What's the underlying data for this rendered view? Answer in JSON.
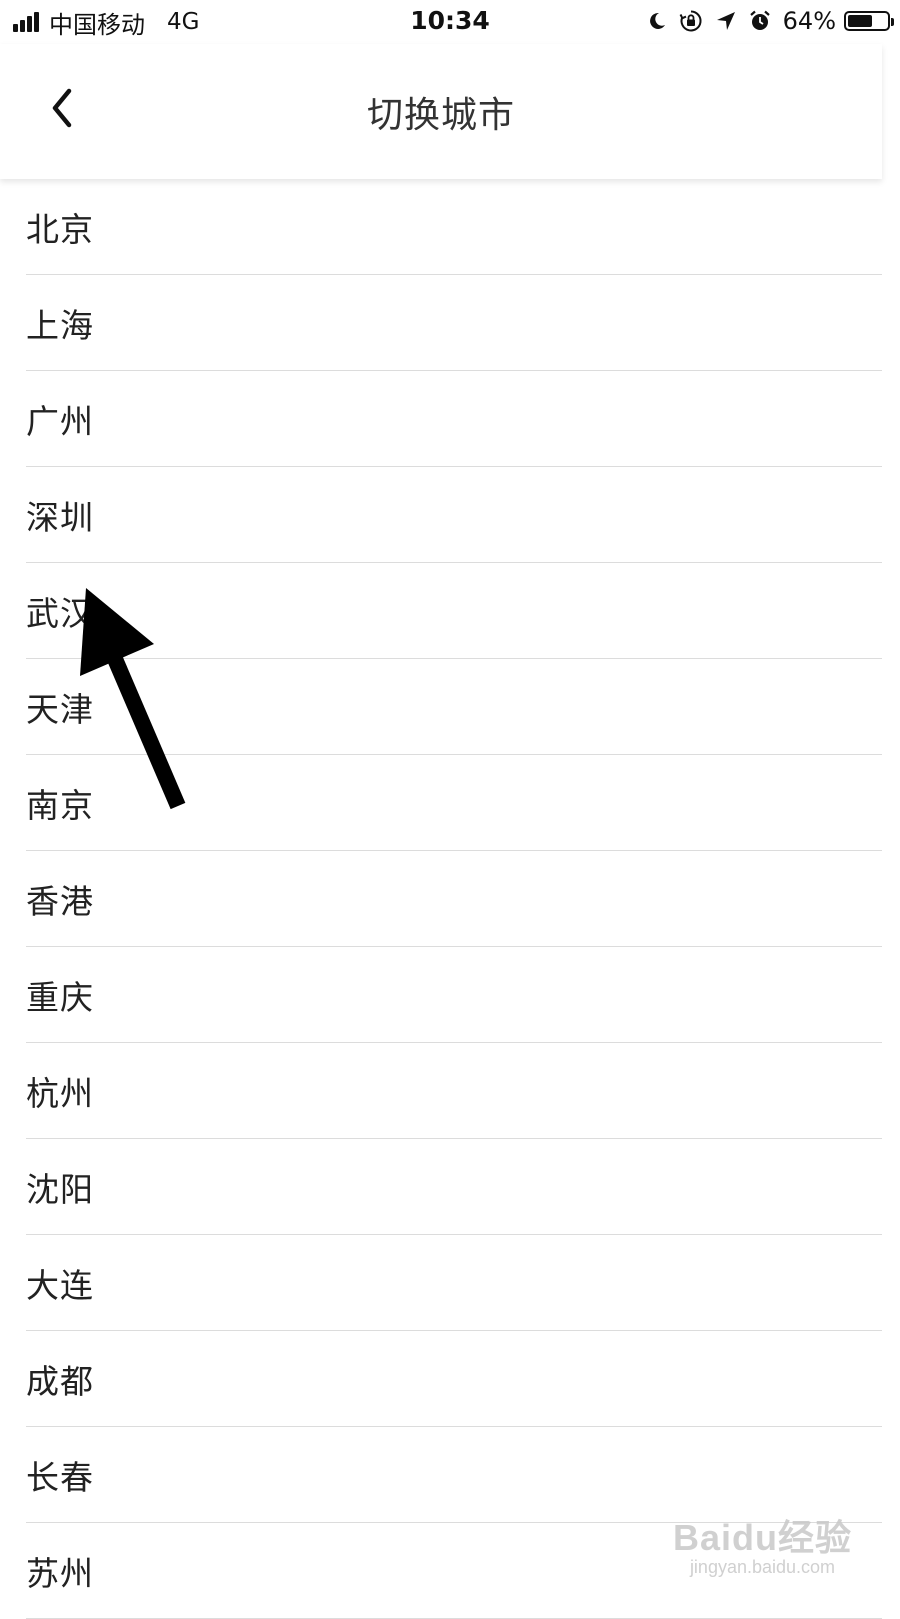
{
  "status_bar": {
    "carrier": "中国移动",
    "network": "4G",
    "time": "10:34",
    "battery_percent": "64%",
    "battery_level": 0.64,
    "icons": [
      "signal-icon",
      "moon-icon",
      "rotation-lock-icon",
      "location-arrow-icon",
      "alarm-icon",
      "battery-icon"
    ]
  },
  "nav": {
    "title": "切换城市",
    "back_icon": "chevron-left-icon"
  },
  "cities": [
    "北京",
    "上海",
    "广州",
    "深圳",
    "武汉",
    "天津",
    "南京",
    "香港",
    "重庆",
    "杭州",
    "沈阳",
    "大连",
    "成都",
    "长春",
    "苏州"
  ],
  "colors": {
    "annotation_arrow": "#000000",
    "divider": "#dcdcdc"
  },
  "watermark": {
    "logo": "Baidu经验",
    "url": "jingyan.baidu.com"
  }
}
